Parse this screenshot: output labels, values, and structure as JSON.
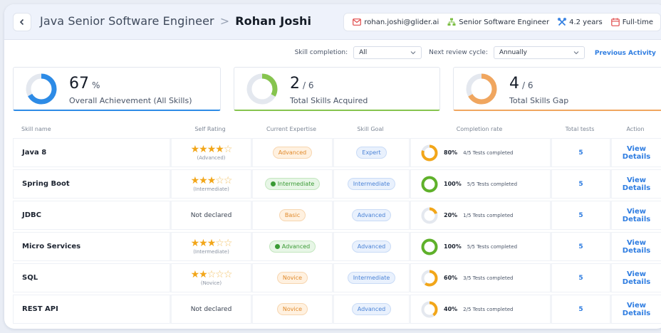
{
  "header": {
    "role_title": "Java Senior Software Engineer",
    "separator": ">",
    "person_name": "Rohan Joshi",
    "email": "rohan.joshi@glider.ai",
    "designation": "Senior Software Engineer",
    "experience": "4.2 years",
    "employment_type": "Full-time"
  },
  "filters": {
    "skill_completion_label": "Skill completion:",
    "skill_completion_value": "All",
    "review_cycle_label": "Next review cycle:",
    "review_cycle_value": "Annually",
    "previous_activity": "Previous Activity"
  },
  "summary": [
    {
      "value": "67",
      "suffix": "%",
      "label": "Overall Achievement (All Skills)",
      "fraction": 0.67,
      "color": "#2d8be6"
    },
    {
      "value": "2",
      "suffix": "/ 6",
      "label": "Total Skills Acquired",
      "fraction": 0.333,
      "color": "#86c44e"
    },
    {
      "value": "4",
      "suffix": "/ 6",
      "label": "Total Skills Gap",
      "fraction": 0.667,
      "color": "#f0a65f"
    }
  ],
  "table": {
    "headers": [
      "Skill name",
      "Self Rating",
      "Current Expertise",
      "Skill Goal",
      "Completion rate",
      "Total tests",
      "Action"
    ],
    "rows": [
      {
        "skill": "Java 8",
        "stars": 4,
        "rating_text": "(Advanced)",
        "expertise": "Advanced",
        "expertise_style": "orange",
        "expertise_icon": false,
        "goal": "Expert",
        "pct": "80%",
        "fraction": 0.8,
        "ring_color": "#f2a619",
        "tests_completed": "4/5 Tests completed",
        "total": "5",
        "action": "View Details"
      },
      {
        "skill": "Spring Boot",
        "stars": 3,
        "rating_text": "(Intermediate)",
        "expertise": "Intermediate",
        "expertise_style": "green",
        "expertise_icon": true,
        "goal": "Intermediate",
        "pct": "100%",
        "fraction": 1.0,
        "ring_color": "#5fb12a",
        "tests_completed": "5/5 Tests completed",
        "total": "5",
        "action": "View Details"
      },
      {
        "skill": "JDBC",
        "stars": 0,
        "rating_text": "",
        "not_declared": "Not declared",
        "expertise": "Basic",
        "expertise_style": "orange",
        "expertise_icon": false,
        "goal": "Advanced",
        "pct": "20%",
        "fraction": 0.2,
        "ring_color": "#f2a619",
        "tests_completed": "1/5 Tests completed",
        "total": "5",
        "action": "View Details"
      },
      {
        "skill": "Micro Services",
        "stars": 3,
        "rating_text": "(Intermediate)",
        "expertise": "Advanced",
        "expertise_style": "green",
        "expertise_icon": true,
        "goal": "Advanced",
        "pct": "100%",
        "fraction": 1.0,
        "ring_color": "#5fb12a",
        "tests_completed": "5/5 Tests completed",
        "total": "5",
        "action": "View Details"
      },
      {
        "skill": "SQL",
        "stars": 2,
        "rating_text": "(Novice)",
        "expertise": "Novice",
        "expertise_style": "orange",
        "expertise_icon": false,
        "goal": "Intermediate",
        "pct": "60%",
        "fraction": 0.6,
        "ring_color": "#f2a619",
        "tests_completed": "3/5 Tests completed",
        "total": "5",
        "action": "View Details"
      },
      {
        "skill": "REST API",
        "stars": 0,
        "rating_text": "",
        "not_declared": "Not declared",
        "expertise": "Novice",
        "expertise_style": "orange",
        "expertise_icon": false,
        "goal": "Advanced",
        "pct": "40%",
        "fraction": 0.4,
        "ring_color": "#f2a619",
        "tests_completed": "2/5 Tests completed",
        "total": "5",
        "action": "View Details"
      }
    ]
  },
  "icons": {
    "back": "chevron-left-icon",
    "email": "mail-icon",
    "designation": "person-tree-icon",
    "experience": "tools-icon",
    "employment_type": "calendar-icon"
  }
}
